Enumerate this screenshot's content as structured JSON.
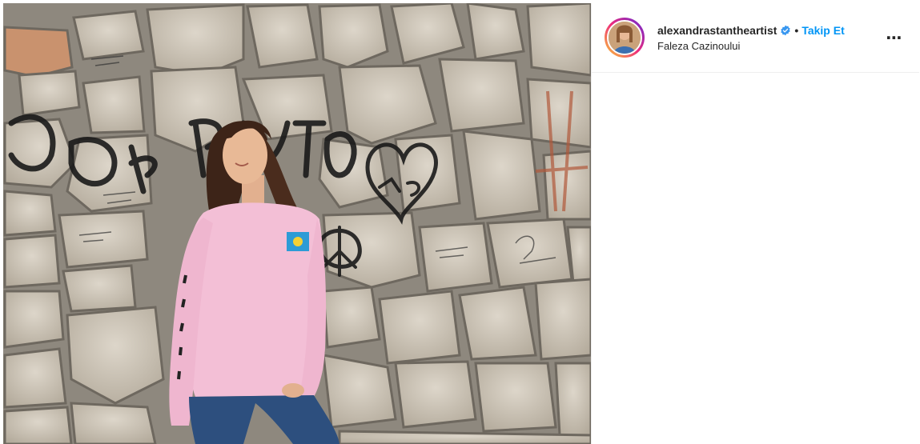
{
  "post": {
    "author": {
      "username": "alexandrastantheartist",
      "verified": true,
      "separator": "•",
      "follow_label": "Takip Et",
      "location": "Faleza Cazinoului",
      "avatar_icon": "profile-photo"
    },
    "more_icon": "⋯",
    "photo": {
      "wall_color": "#c9c2b6",
      "sweater_color": "#f3bfd6",
      "jeans_color": "#2d4f7e",
      "graffiti_color": "#1a1a1a"
    },
    "colors": {
      "follow": "#0095f6",
      "text": "#262626",
      "verified": "#3897f0"
    }
  }
}
